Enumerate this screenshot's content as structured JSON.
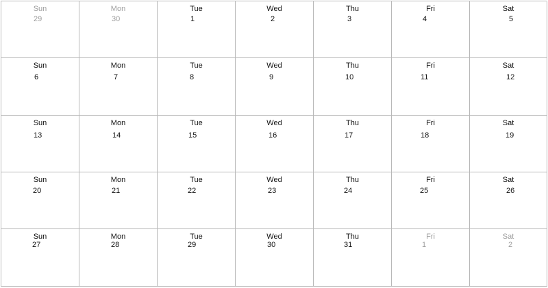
{
  "calendar": {
    "weeks": [
      [
        {
          "weekday": "Sun",
          "day": "29",
          "outside": true
        },
        {
          "weekday": "Mon",
          "day": "30",
          "outside": true
        },
        {
          "weekday": "Tue",
          "day": "1",
          "outside": false
        },
        {
          "weekday": "Wed",
          "day": "2",
          "outside": false
        },
        {
          "weekday": "Thu",
          "day": "3",
          "outside": false
        },
        {
          "weekday": "Fri",
          "day": "4",
          "outside": false
        },
        {
          "weekday": "Sat",
          "day": "5",
          "outside": false
        }
      ],
      [
        {
          "weekday": "Sun",
          "day": "6",
          "outside": false
        },
        {
          "weekday": "Mon",
          "day": "7",
          "outside": false
        },
        {
          "weekday": "Tue",
          "day": "8",
          "outside": false
        },
        {
          "weekday": "Wed",
          "day": "9",
          "outside": false
        },
        {
          "weekday": "Thu",
          "day": "10",
          "outside": false
        },
        {
          "weekday": "Fri",
          "day": "11",
          "outside": false
        },
        {
          "weekday": "Sat",
          "day": "12",
          "outside": false
        }
      ],
      [
        {
          "weekday": "Sun",
          "day": "13",
          "outside": false
        },
        {
          "weekday": "Mon",
          "day": "14",
          "outside": false
        },
        {
          "weekday": "Tue",
          "day": "15",
          "outside": false
        },
        {
          "weekday": "Wed",
          "day": "16",
          "outside": false
        },
        {
          "weekday": "Thu",
          "day": "17",
          "outside": false
        },
        {
          "weekday": "Fri",
          "day": "18",
          "outside": false
        },
        {
          "weekday": "Sat",
          "day": "19",
          "outside": false
        }
      ],
      [
        {
          "weekday": "Sun",
          "day": "20",
          "outside": false
        },
        {
          "weekday": "Mon",
          "day": "21",
          "outside": false
        },
        {
          "weekday": "Tue",
          "day": "22",
          "outside": false
        },
        {
          "weekday": "Wed",
          "day": "23",
          "outside": false
        },
        {
          "weekday": "Thu",
          "day": "24",
          "outside": false
        },
        {
          "weekday": "Fri",
          "day": "25",
          "outside": false
        },
        {
          "weekday": "Sat",
          "day": "26",
          "outside": false
        }
      ],
      [
        {
          "weekday": "Sun",
          "day": "27",
          "outside": false
        },
        {
          "weekday": "Mon",
          "day": "28",
          "outside": false
        },
        {
          "weekday": "Tue",
          "day": "29",
          "outside": false
        },
        {
          "weekday": "Wed",
          "day": "30",
          "outside": false
        },
        {
          "weekday": "Thu",
          "day": "31",
          "outside": false
        },
        {
          "weekday": "Fri",
          "day": "1",
          "outside": true
        },
        {
          "weekday": "Sat",
          "day": "2",
          "outside": true
        }
      ]
    ],
    "colors": {
      "grid_line": "#b8b8b8",
      "text": "#111111",
      "outside_month_text": "#9e9e9e",
      "background": "#ffffff"
    }
  }
}
